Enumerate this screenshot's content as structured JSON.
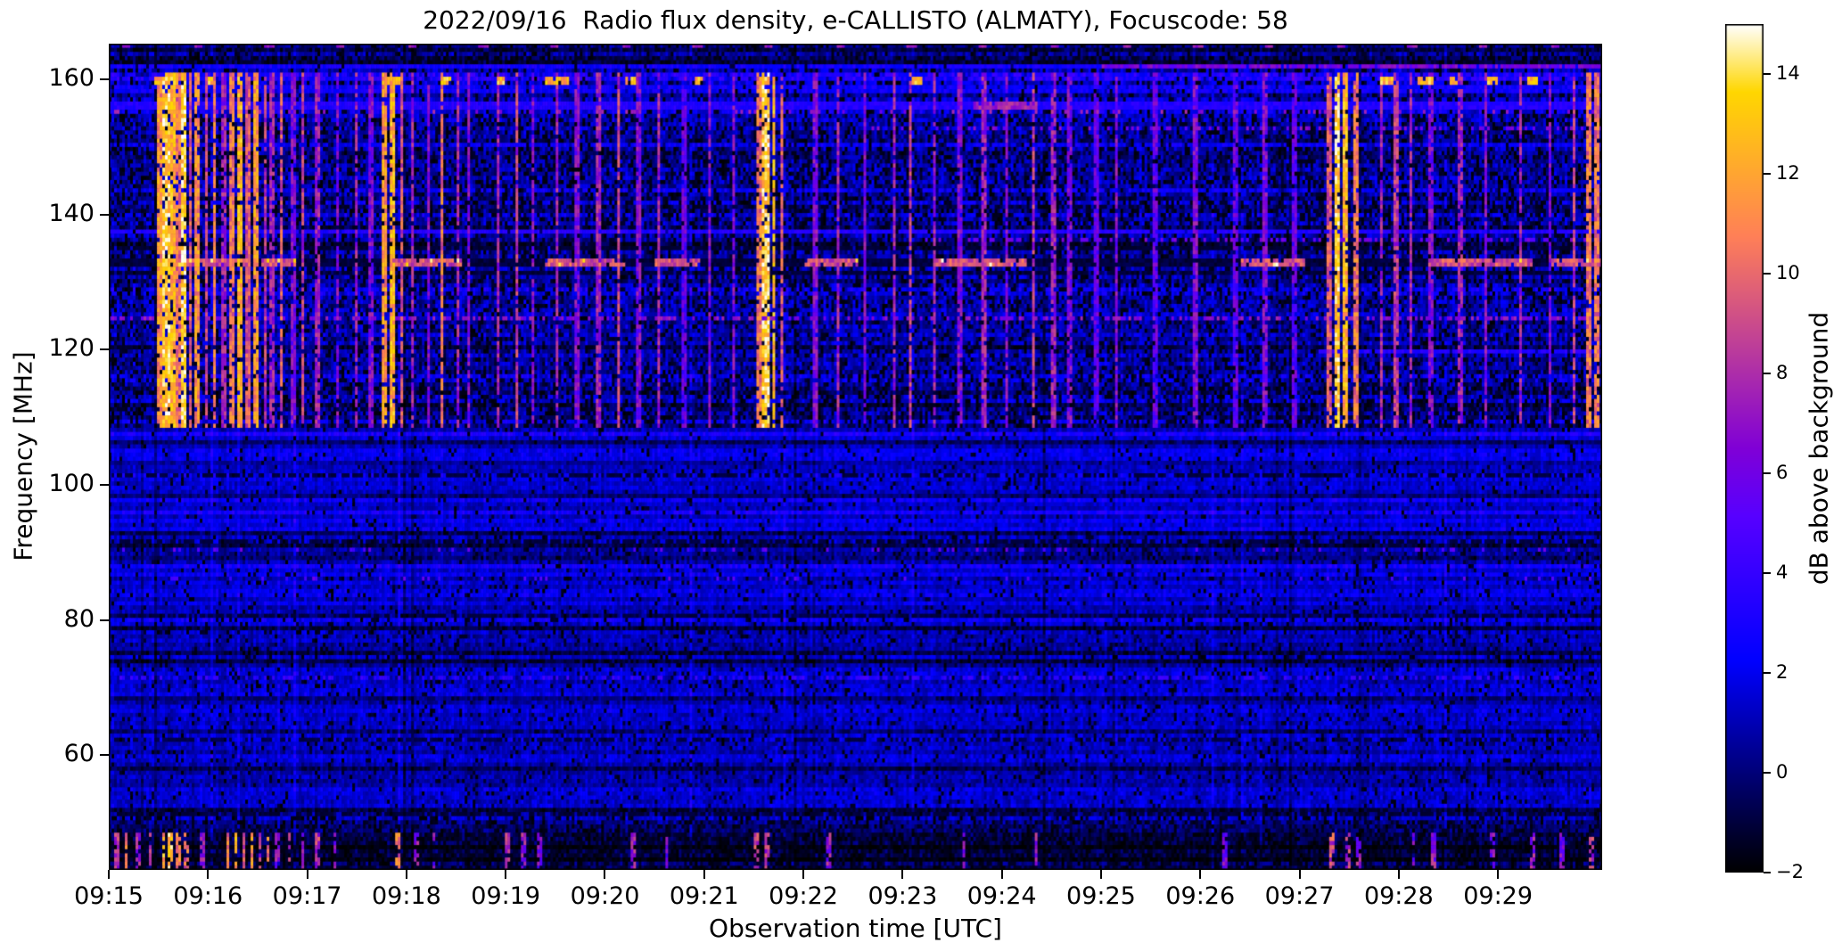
{
  "chart_data": {
    "type": "heatmap",
    "subtype": "radio-spectrogram",
    "title": "2022/09/16  Radio flux density, e-CALLISTO (ALMATY), Focuscode: 58",
    "xlabel": "Observation time [UTC]",
    "ylabel": "Frequency [MHz]",
    "colorbar_label": "dB above background",
    "colormap": "gnuplot2",
    "x_axis": {
      "start_minutes": 0,
      "end_minutes": 15.05,
      "tick_minutes": [
        0,
        1,
        2,
        3,
        4,
        5,
        6,
        7,
        8,
        9,
        10,
        11,
        12,
        13,
        14
      ],
      "tick_labels": [
        "09:15",
        "09:16",
        "09:17",
        "09:18",
        "09:19",
        "09:20",
        "09:21",
        "09:22",
        "09:23",
        "09:24",
        "09:25",
        "09:26",
        "09:27",
        "09:28",
        "09:29"
      ]
    },
    "y_axis": {
      "min": 43.0,
      "max": 165.3,
      "ticks": [
        160,
        140,
        120,
        100,
        80,
        60
      ]
    },
    "colorbar": {
      "min": -2,
      "max": 15,
      "ticks": [
        14,
        12,
        10,
        8,
        6,
        4,
        2,
        0,
        -2
      ]
    },
    "render_seed": 20220916,
    "background_bands": [
      {
        "f_lo": 163.2,
        "f_hi": 165.3,
        "mean": 0.7,
        "noise": 1.0,
        "black": 0.18
      },
      {
        "f_lo": 161.4,
        "f_hi": 163.2,
        "mean": -0.6,
        "noise": 0.9,
        "black": 0.45
      },
      {
        "f_lo": 154.0,
        "f_hi": 161.4,
        "mean": 1.1,
        "noise": 1.2,
        "black": 0.22
      },
      {
        "f_lo": 148.0,
        "f_hi": 154.0,
        "mean": 0.9,
        "noise": 1.3,
        "black": 0.28
      },
      {
        "f_lo": 138.0,
        "f_hi": 148.0,
        "mean": 0.5,
        "noise": 1.2,
        "black": 0.32
      },
      {
        "f_lo": 126.0,
        "f_hi": 138.0,
        "mean": 0.8,
        "noise": 1.3,
        "black": 0.26
      },
      {
        "f_lo": 117.0,
        "f_hi": 126.0,
        "mean": 1.0,
        "noise": 1.2,
        "black": 0.22
      },
      {
        "f_lo": 108.5,
        "f_hi": 117.0,
        "mean": 0.8,
        "noise": 1.3,
        "black": 0.3
      },
      {
        "f_lo": 93.0,
        "f_hi": 108.5,
        "mean": 1.7,
        "noise": 0.8,
        "black": 0.05
      },
      {
        "f_lo": 88.0,
        "f_hi": 93.0,
        "mean": 1.1,
        "noise": 0.9,
        "black": 0.12
      },
      {
        "f_lo": 81.0,
        "f_hi": 88.0,
        "mean": 1.4,
        "noise": 0.8,
        "black": 0.08
      },
      {
        "f_lo": 72.0,
        "f_hi": 81.0,
        "mean": 1.0,
        "noise": 0.9,
        "black": 0.12
      },
      {
        "f_lo": 52.0,
        "f_hi": 72.0,
        "mean": 1.3,
        "noise": 0.9,
        "black": 0.08
      },
      {
        "f_lo": 48.5,
        "f_hi": 52.0,
        "mean": 0.3,
        "noise": 0.9,
        "black": 0.28
      },
      {
        "f_lo": 43.0,
        "f_hi": 48.5,
        "mean": -0.5,
        "noise": 0.9,
        "black": 0.45
      }
    ],
    "horizontal_lines": [
      {
        "f": 164.8,
        "w": 0.8,
        "level": 7.2,
        "jitter": 1.0,
        "period": 0.72,
        "phase": 0.13,
        "dotw": 0.09
      },
      {
        "f": 162.0,
        "w": 0.7,
        "level": 2.8,
        "duty": 0.95,
        "jitter": 0.8
      },
      {
        "f": 162.0,
        "w": 0.8,
        "level": 6.2,
        "duty": 0.95,
        "jitter": 1.2,
        "segments": [
          [
            10.0,
            15.05
          ]
        ]
      },
      {
        "f": 160.3,
        "w": 0.9,
        "level": 3.2,
        "duty": 0.85,
        "jitter": 1.2
      },
      {
        "f": 159.9,
        "w": 1.0,
        "level": 12.5,
        "duty": 0.9,
        "jitter": 1.8,
        "segments": [
          [
            0.45,
            0.58
          ],
          [
            0.62,
            0.7
          ],
          [
            0.95,
            1.05
          ],
          [
            2.8,
            2.95
          ],
          [
            3.35,
            3.45
          ],
          [
            3.9,
            4.0
          ],
          [
            4.4,
            4.65
          ],
          [
            5.2,
            5.3
          ],
          [
            5.9,
            6.0
          ],
          [
            6.55,
            6.65
          ],
          [
            8.1,
            8.2
          ],
          [
            12.8,
            12.95
          ],
          [
            13.2,
            13.35
          ],
          [
            13.5,
            13.6
          ],
          [
            13.9,
            14.0
          ],
          [
            14.3,
            14.4
          ]
        ]
      },
      {
        "f": 158.6,
        "w": 0.7,
        "level": 2.6,
        "duty": 0.9,
        "jitter": 0.8
      },
      {
        "f": 157.4,
        "w": 0.5,
        "level": -1.4,
        "duty": 0.8,
        "jitter": 0.5
      },
      {
        "f": 156.2,
        "w": 0.8,
        "level": 3.4,
        "duty": 1.0,
        "jitter": 0.6
      },
      {
        "f": 156.2,
        "w": 0.9,
        "level": 7.5,
        "duty": 0.9,
        "jitter": 1.3,
        "segments": [
          [
            8.7,
            9.35
          ]
        ]
      },
      {
        "f": 155.1,
        "w": 0.6,
        "level": 7.0,
        "duty": 0.12,
        "jitter": 1.2
      },
      {
        "f": 152.8,
        "w": 0.6,
        "level": 6.2,
        "duty": 0.25,
        "jitter": 1.2,
        "segments": [
          [
            7.5,
            15.05
          ]
        ]
      },
      {
        "f": 150.3,
        "w": 0.6,
        "level": 2.4,
        "duty": 0.75,
        "jitter": 0.8
      },
      {
        "f": 143.6,
        "w": 0.6,
        "level": 2.4,
        "duty": 0.7,
        "jitter": 0.8
      },
      {
        "f": 137.6,
        "w": 0.8,
        "level": 3.3,
        "duty": 0.95,
        "jitter": 0.6
      },
      {
        "f": 136.3,
        "w": 0.6,
        "level": 6.0,
        "duty": 0.3,
        "jitter": 1.0,
        "segments": [
          [
            8.2,
            15.05
          ]
        ]
      },
      {
        "f": 135.2,
        "w": 0.6,
        "level": -1.4,
        "duty": 0.8,
        "jitter": 0.5
      },
      {
        "f": 133.0,
        "w": 1.3,
        "level": 9.2,
        "duty": 0.9,
        "jitter": 1.6,
        "base": -1.4,
        "hot": 0.06,
        "segments": [
          [
            0.68,
            1.4
          ],
          [
            1.55,
            1.9
          ],
          [
            2.85,
            3.55
          ],
          [
            4.4,
            5.2
          ],
          [
            5.5,
            5.95
          ],
          [
            7.0,
            7.55
          ],
          [
            8.3,
            9.25
          ],
          [
            11.4,
            12.05
          ],
          [
            13.3,
            14.35
          ],
          [
            14.55,
            15.05
          ]
        ]
      },
      {
        "f": 131.4,
        "w": 0.6,
        "level": -1.3,
        "duty": 0.7,
        "jitter": 0.5
      },
      {
        "f": 124.8,
        "w": 0.7,
        "level": 6.6,
        "duty": 0.45,
        "jitter": 1.3
      },
      {
        "f": 121.3,
        "w": 0.5,
        "level": -1.3,
        "duty": 0.7,
        "jitter": 0.5
      },
      {
        "f": 119.6,
        "w": 0.8,
        "level": 3.4,
        "duty": 0.95,
        "jitter": 0.7,
        "segments": [
          [
            12.2,
            15.05
          ]
        ]
      },
      {
        "f": 101.4,
        "w": 0.5,
        "level": -1.2,
        "duty": 0.6,
        "jitter": 0.5
      },
      {
        "f": 91.5,
        "w": 0.5,
        "level": -1.2,
        "duty": 0.6,
        "jitter": 0.5
      },
      {
        "f": 90.6,
        "w": 0.5,
        "level": 5.2,
        "duty": 0.1,
        "jitter": 1.0
      },
      {
        "f": 86.0,
        "w": 0.5,
        "level": 5.0,
        "duty": 0.08,
        "jitter": 1.0
      },
      {
        "f": 80.6,
        "w": 0.5,
        "level": -1.2,
        "duty": 0.6,
        "jitter": 0.5
      },
      {
        "f": 71.2,
        "w": 0.6,
        "level": 3.6,
        "duty": 0.5,
        "jitter": 1.0
      },
      {
        "f": 62.5,
        "w": 0.5,
        "level": -1.0,
        "duty": 0.5,
        "jitter": 0.5
      },
      {
        "f": 51.2,
        "w": 0.5,
        "level": -1.3,
        "duty": 0.6,
        "jitter": 0.5
      }
    ],
    "vertical_bursts": {
      "f_lo": 108.3,
      "f_hi": 160.9,
      "default_width": 0.03,
      "events": [
        [
          0.52,
          13,
          0.05
        ],
        [
          0.58,
          15,
          0.05
        ],
        [
          0.64,
          14,
          0.04
        ],
        [
          0.7,
          12
        ],
        [
          0.76,
          15,
          0.05
        ],
        [
          0.83,
          11
        ],
        [
          0.9,
          13,
          0.04
        ],
        [
          0.98,
          10
        ],
        [
          1.06,
          12
        ],
        [
          1.16,
          9
        ],
        [
          1.24,
          12
        ],
        [
          1.32,
          14,
          0.04
        ],
        [
          1.4,
          11
        ],
        [
          1.48,
          13,
          0.04
        ],
        [
          1.57,
          10
        ],
        [
          1.65,
          9
        ],
        [
          1.74,
          11
        ],
        [
          1.86,
          8
        ],
        [
          1.96,
          10
        ],
        [
          2.1,
          9
        ],
        [
          2.3,
          8
        ],
        [
          2.5,
          9
        ],
        [
          2.64,
          8
        ],
        [
          2.78,
          13,
          0.04
        ],
        [
          2.86,
          14,
          0.04
        ],
        [
          2.96,
          11
        ],
        [
          3.06,
          9
        ],
        [
          3.22,
          8
        ],
        [
          3.36,
          12
        ],
        [
          3.52,
          9
        ],
        [
          3.62,
          8
        ],
        [
          3.92,
          9
        ],
        [
          4.12,
          10
        ],
        [
          4.28,
          8
        ],
        [
          4.52,
          9
        ],
        [
          4.72,
          8
        ],
        [
          4.94,
          9
        ],
        [
          5.14,
          10
        ],
        [
          5.34,
          8
        ],
        [
          5.55,
          9
        ],
        [
          5.8,
          7
        ],
        [
          6.05,
          8
        ],
        [
          6.3,
          8
        ],
        [
          6.55,
          12,
          0.04
        ],
        [
          6.62,
          15,
          0.05
        ],
        [
          6.7,
          14,
          0.04
        ],
        [
          6.79,
          11
        ],
        [
          7.12,
          8
        ],
        [
          7.35,
          9
        ],
        [
          7.62,
          8
        ],
        [
          7.92,
          9
        ],
        [
          8.08,
          10
        ],
        [
          8.32,
          9
        ],
        [
          8.58,
          8
        ],
        [
          8.82,
          9
        ],
        [
          9.05,
          8
        ],
        [
          9.32,
          10
        ],
        [
          9.52,
          9
        ],
        [
          9.68,
          8
        ],
        [
          9.95,
          7
        ],
        [
          10.15,
          8
        ],
        [
          10.55,
          7
        ],
        [
          10.95,
          8
        ],
        [
          11.35,
          7
        ],
        [
          11.65,
          8
        ],
        [
          11.95,
          7
        ],
        [
          12.3,
          11,
          0.04
        ],
        [
          12.38,
          15,
          0.05
        ],
        [
          12.46,
          14,
          0.04
        ],
        [
          12.56,
          12,
          0.04
        ],
        [
          12.82,
          9
        ],
        [
          12.97,
          10
        ],
        [
          13.12,
          9
        ],
        [
          13.32,
          8
        ],
        [
          13.62,
          9
        ],
        [
          13.88,
          8
        ],
        [
          14.22,
          9
        ],
        [
          14.52,
          8
        ],
        [
          14.76,
          10
        ],
        [
          14.92,
          12
        ],
        [
          15.0,
          12
        ]
      ]
    },
    "bottom_band_bursts": {
      "f_lo": 43.2,
      "f_hi": 48.6,
      "default_width": 0.035,
      "events": [
        [
          0.08,
          10
        ],
        [
          0.18,
          12
        ],
        [
          0.3,
          9
        ],
        [
          0.42,
          11
        ],
        [
          0.55,
          14
        ],
        [
          0.62,
          15
        ],
        [
          0.7,
          13
        ],
        [
          0.78,
          12
        ],
        [
          0.95,
          9
        ],
        [
          1.2,
          12
        ],
        [
          1.28,
          14
        ],
        [
          1.36,
          11
        ],
        [
          1.44,
          13
        ],
        [
          1.52,
          10
        ],
        [
          1.6,
          12
        ],
        [
          1.7,
          9
        ],
        [
          1.82,
          10
        ],
        [
          1.95,
          9
        ],
        [
          2.1,
          10
        ],
        [
          2.28,
          8
        ],
        [
          2.92,
          12
        ],
        [
          3.1,
          9
        ],
        [
          3.28,
          8
        ],
        [
          4.02,
          10
        ],
        [
          4.18,
          9
        ],
        [
          4.35,
          8
        ],
        [
          5.28,
          9
        ],
        [
          5.62,
          8
        ],
        [
          6.52,
          11
        ],
        [
          6.64,
          10
        ],
        [
          7.25,
          9
        ],
        [
          8.62,
          8
        ],
        [
          9.35,
          9
        ],
        [
          11.25,
          8
        ],
        [
          12.32,
          11
        ],
        [
          12.48,
          10
        ],
        [
          12.6,
          9
        ],
        [
          13.15,
          8
        ],
        [
          13.35,
          9
        ],
        [
          13.95,
          8
        ],
        [
          14.35,
          9
        ],
        [
          14.65,
          8
        ],
        [
          14.95,
          10
        ]
      ]
    }
  }
}
